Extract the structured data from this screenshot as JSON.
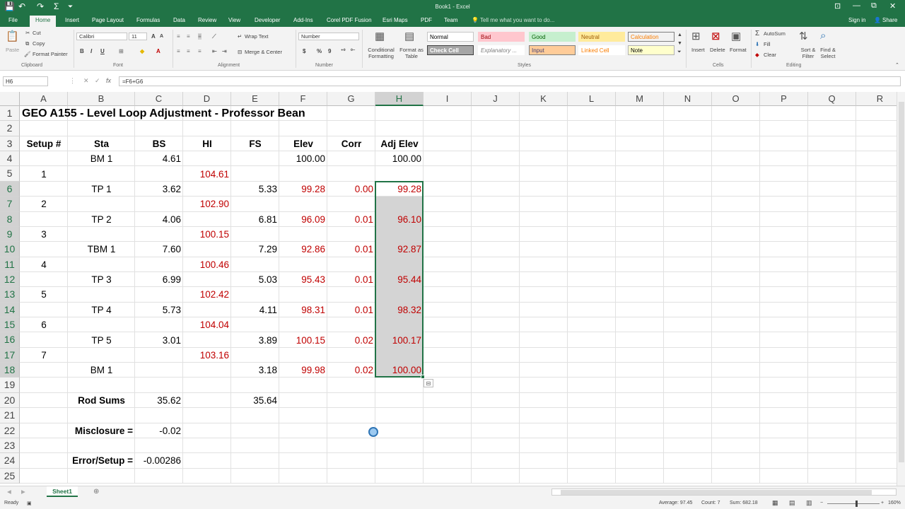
{
  "window": {
    "title": "Book1 - Excel",
    "controls": [
      "⊡",
      "—",
      "⧉",
      "✕"
    ]
  },
  "quick_access": [
    "💾",
    "↶",
    "↷",
    "Σ",
    "⏷"
  ],
  "tabs": [
    "File",
    "Home",
    "Insert",
    "Page Layout",
    "Formulas",
    "Data",
    "Review",
    "View",
    "Developer",
    "Add-Ins",
    "Corel PDF Fusion",
    "Esri Maps",
    "PDF",
    "Team"
  ],
  "tell_me": "Tell me what you want to do...",
  "sign_in": "Sign in",
  "share": "Share",
  "ribbon": {
    "clipboard": {
      "paste": "Paste",
      "cut": "Cut",
      "copy": "Copy",
      "format_painter": "Format Painter",
      "group": "Clipboard"
    },
    "font": {
      "name": "Calibri",
      "size": "11",
      "bold": "B",
      "italic": "I",
      "underline": "U",
      "group": "Font"
    },
    "alignment": {
      "wrap": "Wrap Text",
      "merge": "Merge & Center",
      "group": "Alignment"
    },
    "number": {
      "format": "Number",
      "currency": "$",
      "percent": "%",
      "comma": "9",
      "group": "Number"
    },
    "styles": {
      "conditional": "Conditional Formatting",
      "format_table": "Format as Table",
      "group": "Styles",
      "cells": [
        {
          "label": "Normal",
          "bg": "#ffffff",
          "fg": "#000000",
          "border": "#c6c6c6"
        },
        {
          "label": "Bad",
          "bg": "#ffc7ce",
          "fg": "#9c0006",
          "border": "#ffc7ce"
        },
        {
          "label": "Good",
          "bg": "#c6efce",
          "fg": "#006100",
          "border": "#c6efce"
        },
        {
          "label": "Neutral",
          "bg": "#ffeb9c",
          "fg": "#9c5700",
          "border": "#ffeb9c"
        },
        {
          "label": "Calculation",
          "bg": "#f2f2f2",
          "fg": "#fa7d00",
          "border": "#7f7f7f"
        },
        {
          "label": "Check Cell",
          "bg": "#a5a5a5",
          "fg": "#ffffff",
          "border": "#3f3f3f"
        },
        {
          "label": "Explanatory ...",
          "bg": "#ffffff",
          "fg": "#7f7f7f",
          "border": "#ffffff"
        },
        {
          "label": "Input",
          "bg": "#ffcc99",
          "fg": "#3f3f76",
          "border": "#7f7f7f"
        },
        {
          "label": "Linked Cell",
          "bg": "#ffffff",
          "fg": "#fa7d00",
          "border": "#ffffff"
        },
        {
          "label": "Note",
          "bg": "#ffffcc",
          "fg": "#000000",
          "border": "#b2b2b2"
        }
      ]
    },
    "cells": {
      "insert": "Insert",
      "delete": "Delete",
      "format": "Format",
      "group": "Cells"
    },
    "editing": {
      "autosum": "AutoSum",
      "fill": "Fill",
      "clear": "Clear",
      "sort": "Sort & Filter",
      "find": "Find & Select",
      "group": "Editing"
    }
  },
  "formula_bar": {
    "name_box": "H6",
    "formula": "=F6+G6"
  },
  "columns": [
    "A",
    "B",
    "C",
    "D",
    "E",
    "F",
    "G",
    "H",
    "I",
    "J",
    "K",
    "L",
    "M",
    "N",
    "O",
    "P",
    "Q",
    "R"
  ],
  "selected_column": "H",
  "rows": [
    "1",
    "2",
    "3",
    "4",
    "5",
    "6",
    "7",
    "8",
    "9",
    "10",
    "11",
    "12",
    "13",
    "14",
    "15",
    "16",
    "17",
    "18",
    "19",
    "20",
    "21",
    "22",
    "23",
    "24",
    "25"
  ],
  "selected_rows": [
    "6",
    "7",
    "8",
    "9",
    "10",
    "11",
    "12",
    "13",
    "14",
    "15",
    "16",
    "17",
    "18"
  ],
  "sheet": {
    "title": "GEO A155 - Level Loop Adjustment - Professor Bean",
    "headers": [
      "Setup #",
      "Sta",
      "BS",
      "HI",
      "FS",
      "Elev",
      "Corr",
      "Adj Elev"
    ],
    "data_rows": [
      {
        "row": 4,
        "A": "",
        "B": "BM 1",
        "C": "4.61",
        "D": "",
        "E": "",
        "F": "100.00",
        "G": "",
        "H": "100.00"
      },
      {
        "row": 5,
        "A": "1",
        "B": "",
        "C": "",
        "D": "104.61",
        "E": "",
        "F": "",
        "G": "",
        "H": ""
      },
      {
        "row": 6,
        "A": "",
        "B": "TP 1",
        "C": "3.62",
        "D": "",
        "E": "5.33",
        "F": "99.28",
        "G": "0.00",
        "H": "99.28"
      },
      {
        "row": 7,
        "A": "2",
        "B": "",
        "C": "",
        "D": "102.90",
        "E": "",
        "F": "",
        "G": "",
        "H": ""
      },
      {
        "row": 8,
        "A": "",
        "B": "TP 2",
        "C": "4.06",
        "D": "",
        "E": "6.81",
        "F": "96.09",
        "G": "0.01",
        "H": "96.10"
      },
      {
        "row": 9,
        "A": "3",
        "B": "",
        "C": "",
        "D": "100.15",
        "E": "",
        "F": "",
        "G": "",
        "H": ""
      },
      {
        "row": 10,
        "A": "",
        "B": "TBM 1",
        "C": "7.60",
        "D": "",
        "E": "7.29",
        "F": "92.86",
        "G": "0.01",
        "H": "92.87"
      },
      {
        "row": 11,
        "A": "4",
        "B": "",
        "C": "",
        "D": "100.46",
        "E": "",
        "F": "",
        "G": "",
        "H": ""
      },
      {
        "row": 12,
        "A": "",
        "B": "TP 3",
        "C": "6.99",
        "D": "",
        "E": "5.03",
        "F": "95.43",
        "G": "0.01",
        "H": "95.44"
      },
      {
        "row": 13,
        "A": "5",
        "B": "",
        "C": "",
        "D": "102.42",
        "E": "",
        "F": "",
        "G": "",
        "H": ""
      },
      {
        "row": 14,
        "A": "",
        "B": "TP 4",
        "C": "5.73",
        "D": "",
        "E": "4.11",
        "F": "98.31",
        "G": "0.01",
        "H": "98.32"
      },
      {
        "row": 15,
        "A": "6",
        "B": "",
        "C": "",
        "D": "104.04",
        "E": "",
        "F": "",
        "G": "",
        "H": ""
      },
      {
        "row": 16,
        "A": "",
        "B": "TP 5",
        "C": "3.01",
        "D": "",
        "E": "3.89",
        "F": "100.15",
        "G": "0.02",
        "H": "100.17"
      },
      {
        "row": 17,
        "A": "7",
        "B": "",
        "C": "",
        "D": "103.16",
        "E": "",
        "F": "",
        "G": "",
        "H": ""
      },
      {
        "row": 18,
        "A": "",
        "B": "BM 1",
        "C": "",
        "D": "",
        "E": "3.18",
        "F": "99.98",
        "G": "0.02",
        "H": "100.00"
      }
    ],
    "rod_sums": {
      "label": "Rod Sums",
      "bs": "35.62",
      "fs": "35.64"
    },
    "misclosure": {
      "label": "Misclosure =",
      "value": "-0.02"
    },
    "error_setup": {
      "label": "Error/Setup =",
      "value": "-0.00286"
    }
  },
  "sheet_tab": "Sheet1",
  "status": {
    "ready": "Ready",
    "average": "Average: 97.45",
    "count": "Count: 7",
    "sum": "Sum: 682.18",
    "zoom": "160%"
  },
  "colors": {
    "accent": "#217346",
    "red_text": "#c00000",
    "selection_fill": "#d4d4d4"
  }
}
